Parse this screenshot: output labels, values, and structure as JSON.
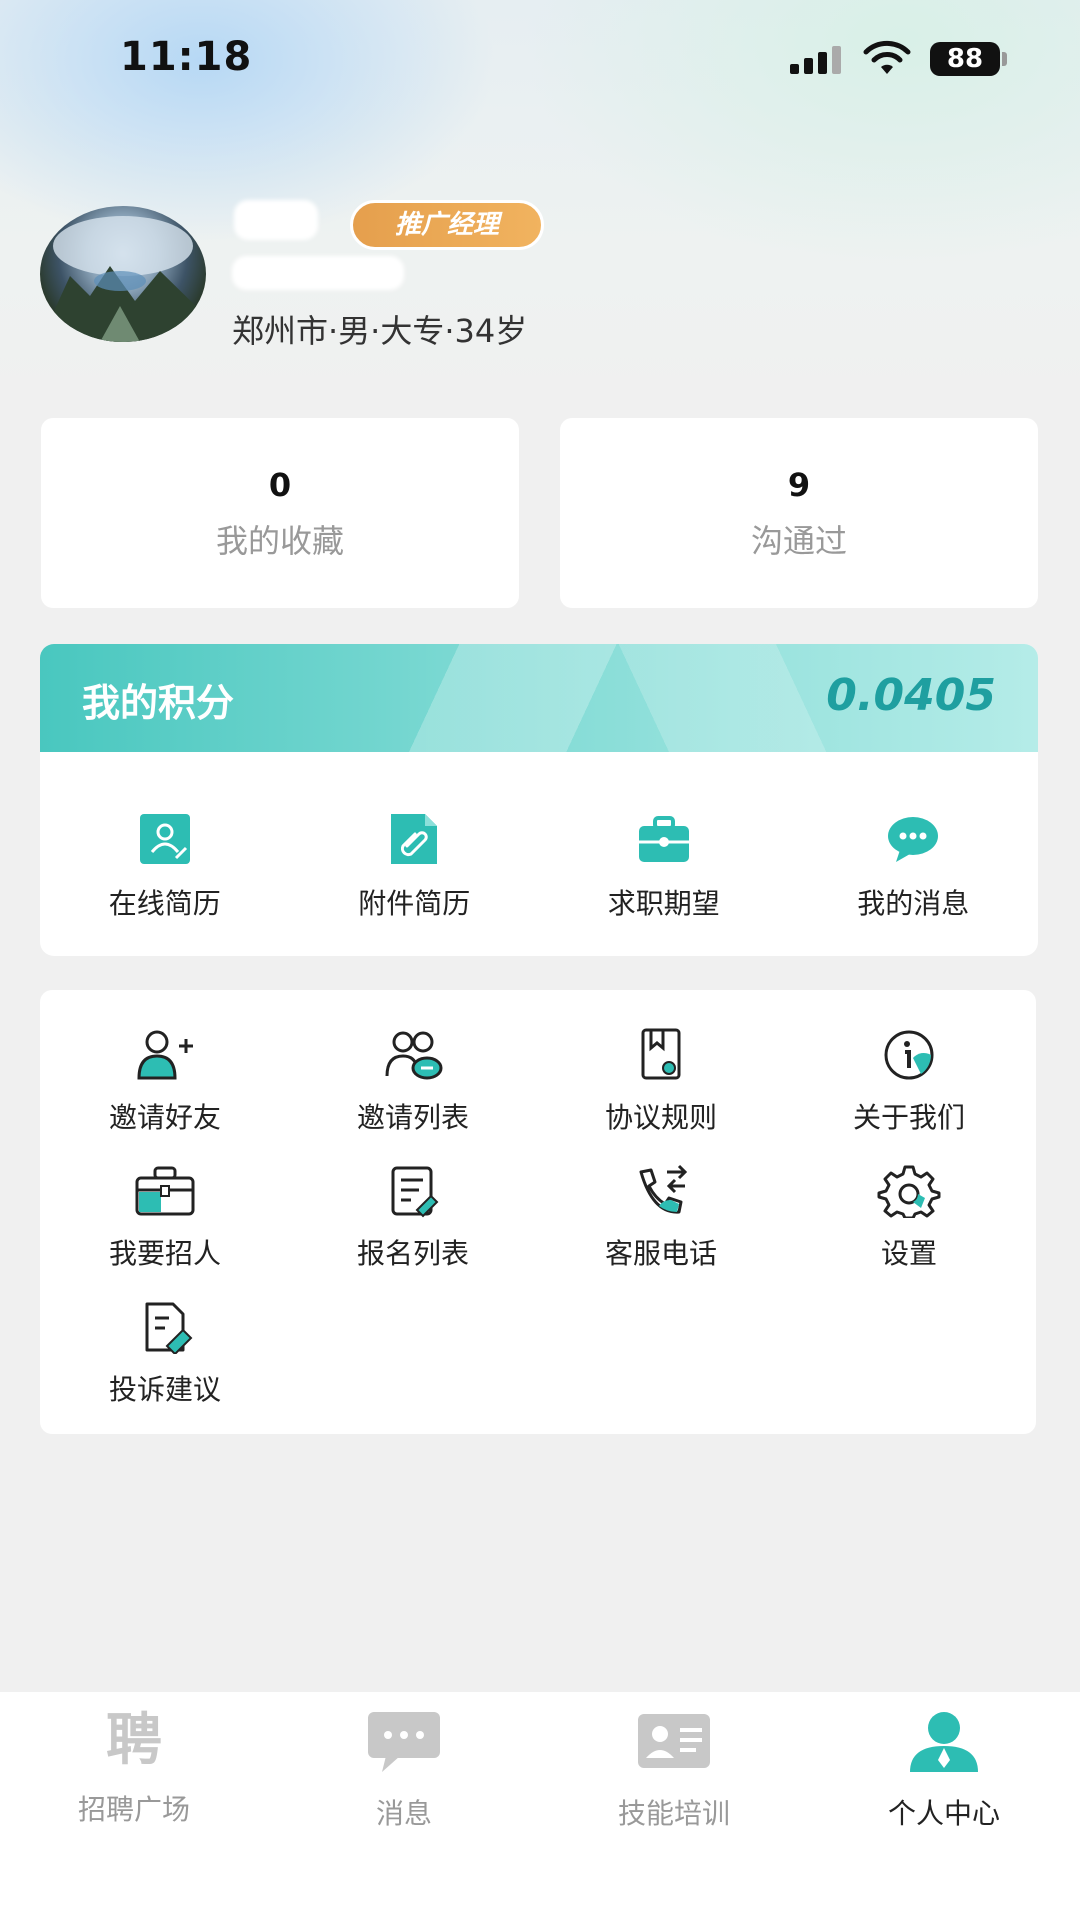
{
  "status_bar": {
    "time": "11:18",
    "battery": "88"
  },
  "profile": {
    "role_badge": "推广经理",
    "info": "郑州市·男·大专·34岁"
  },
  "stats": [
    {
      "value": "0",
      "label": "我的收藏"
    },
    {
      "value": "9",
      "label": "沟通过"
    }
  ],
  "points": {
    "title": "我的积分",
    "value": "0.0405",
    "items": [
      {
        "label": "在线简历",
        "icon": "resume-icon"
      },
      {
        "label": "附件简历",
        "icon": "attachment-icon"
      },
      {
        "label": "求职期望",
        "icon": "briefcase-icon"
      },
      {
        "label": "我的消息",
        "icon": "chat-icon"
      }
    ]
  },
  "menu": {
    "items": [
      {
        "label": "邀请好友",
        "icon": "add-friend-icon"
      },
      {
        "label": "邀请列表",
        "icon": "users-list-icon"
      },
      {
        "label": "协议规则",
        "icon": "document-icon"
      },
      {
        "label": "关于我们",
        "icon": "info-icon"
      },
      {
        "label": "我要招人",
        "icon": "recruit-icon"
      },
      {
        "label": "报名列表",
        "icon": "signup-list-icon"
      },
      {
        "label": "客服电话",
        "icon": "phone-icon"
      },
      {
        "label": "设置",
        "icon": "gear-icon"
      },
      {
        "label": "投诉建议",
        "icon": "feedback-icon"
      }
    ]
  },
  "tabs": [
    {
      "label": "招聘广场",
      "glyph": "聘",
      "active": false
    },
    {
      "label": "消息",
      "active": false
    },
    {
      "label": "技能培训",
      "active": false
    },
    {
      "label": "个人中心",
      "active": true
    }
  ],
  "colors": {
    "accent": "#2dbdb3",
    "badge": "#eaa552",
    "inactive": "#bdbdbd"
  }
}
